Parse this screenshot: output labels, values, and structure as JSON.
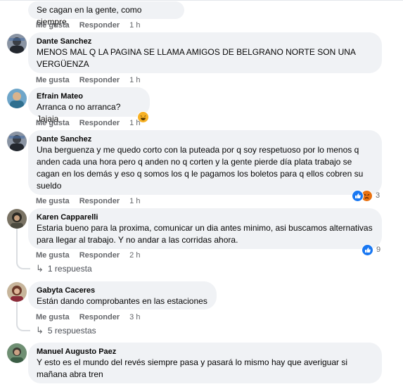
{
  "comments": [
    {
      "author": "",
      "text": "Se cagan en la gente, como siempre.",
      "like": "Me gusta",
      "reply": "Responder",
      "time": "1 h"
    },
    {
      "author": "Dante Sanchez",
      "text": "MENOS MAL Q LA PAGINA SE LLAMA AMIGOS DE BELGRANO NORTE SON UNA VERGÜENZA",
      "like": "Me gusta",
      "reply": "Responder",
      "time": "1 h"
    },
    {
      "author": "Efrain Mateo",
      "text": "Arranca o no arranca? Jajaja",
      "like": "Me gusta",
      "reply": "Responder",
      "time": "1 h"
    },
    {
      "author": "Dante Sanchez",
      "text": "Una berguenza y me quedo corto con la puteada por q soy respetuoso por lo menos q anden cada una hora pero q anden no q corten y la gente pierde día plata trabajo se cagan en los demás y eso q somos los q le pagamos los boletos para q ellos cobren su sueldo",
      "like": "Me gusta",
      "reply": "Responder",
      "time": "1 h",
      "reactions": "3"
    },
    {
      "author": "Karen Capparelli",
      "text": "Estaria bueno para la proxima, comunicar un dia antes minimo, asi buscamos alternativas para llegar al trabajo. Y no andar a las corridas ahora.",
      "like": "Me gusta",
      "reply": "Responder",
      "time": "2 h",
      "reactions": "9",
      "replies": "1 respuesta"
    },
    {
      "author": "Gabyta Caceres",
      "text": "Están dando comprobantes en las estaciones",
      "like": "Me gusta",
      "reply": "Responder",
      "time": "3 h",
      "replies": "5 respuestas"
    },
    {
      "author": "Manuel Augusto Paez",
      "text": "Y esto es el mundo del revés siempre pasa y pasará lo mismo hay que averiguar si mañana abra tren"
    }
  ],
  "colors": {
    "bubble": "#f0f2f5",
    "meta": "#65676b",
    "like_blue": "#1877f2",
    "angry": "#e9710f",
    "haha": "#f7b125"
  }
}
